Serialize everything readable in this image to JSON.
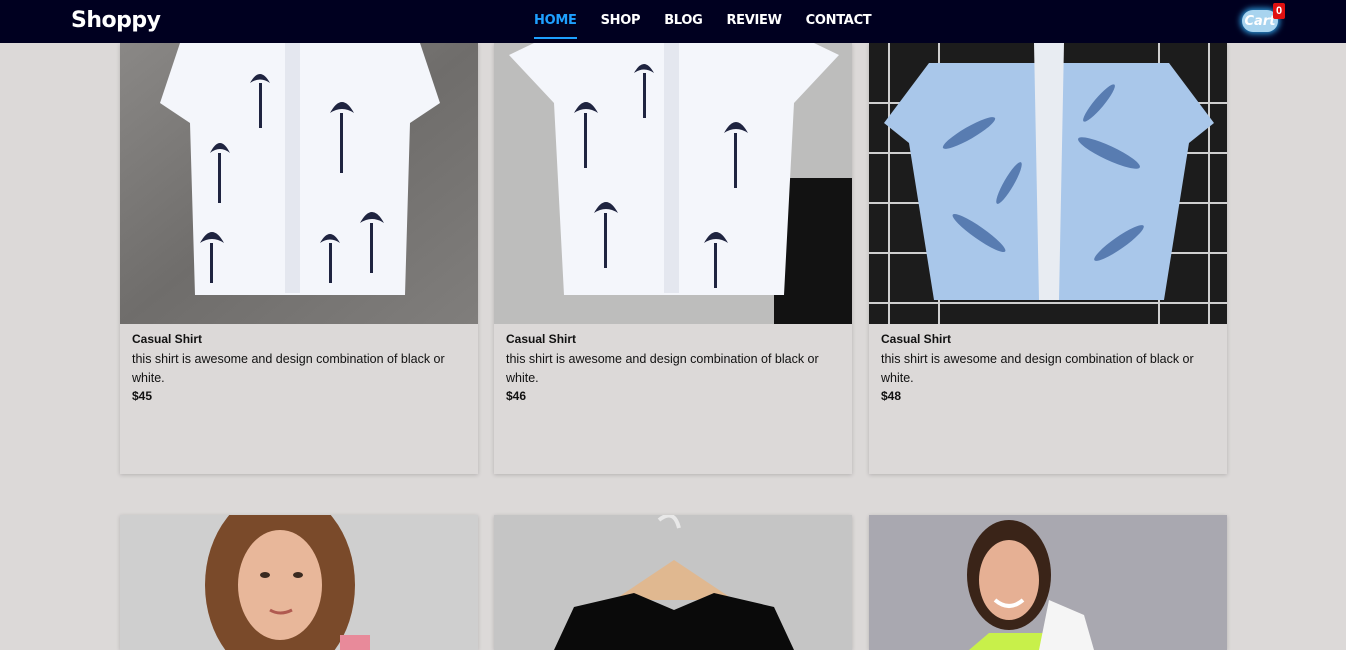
{
  "header": {
    "brand": "Shoppy",
    "nav": [
      {
        "label": "HOME",
        "active": true
      },
      {
        "label": "SHOP",
        "active": false
      },
      {
        "label": "BLOG",
        "active": false
      },
      {
        "label": "REVIEW",
        "active": false
      },
      {
        "label": "CONTACT",
        "active": false
      }
    ],
    "cart_label": "Cart",
    "cart_count": "0"
  },
  "products": [
    {
      "title": "Casual Shirt",
      "description": "this shirt is awesome and design combination of black or white.",
      "price": "$45"
    },
    {
      "title": "Casual Shirt",
      "description": "this shirt is awesome and design combination of black or white.",
      "price": "$46"
    },
    {
      "title": "Casual Shirt",
      "description": "this shirt is awesome and design combination of black or white.",
      "price": "$48"
    }
  ],
  "colors": {
    "navbar_bg": "#000020",
    "accent": "#1ea0ff",
    "page_bg": "#dcd9d8",
    "badge": "#e01010"
  }
}
